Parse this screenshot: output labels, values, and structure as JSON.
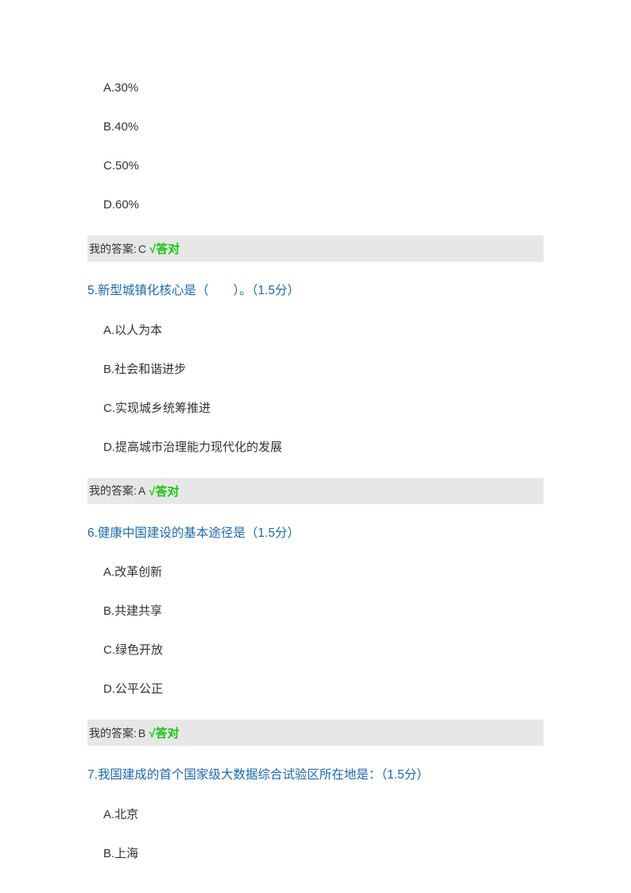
{
  "q4": {
    "options": {
      "a": "A.30%",
      "b": "B.40%",
      "c": "C.50%",
      "d": "D.60%"
    },
    "answer_label": "我的答案:",
    "answer_value": "C",
    "answer_result": "√答对"
  },
  "q5": {
    "title": "5.新型城镇化核心是（　　）。（1.5分）",
    "options": {
      "a": "A.以人为本",
      "b": "B.社会和谐进步",
      "c": "C.实现城乡统筹推进",
      "d": "D.提高城市治理能力现代化的发展"
    },
    "answer_label": "我的答案:",
    "answer_value": "A",
    "answer_result": "√答对"
  },
  "q6": {
    "title": "6.健康中国建设的基本途径是（1.5分）",
    "options": {
      "a": "A.改革创新",
      "b": "B.共建共享",
      "c": "C.绿色开放",
      "d": "D.公平公正"
    },
    "answer_label": "我的答案:",
    "answer_value": "B",
    "answer_result": "√答对"
  },
  "q7": {
    "title": "7.我国建成的首个国家级大数据综合试验区所在地是：（1.5分）",
    "options": {
      "a": "A.北京",
      "b": "B.上海"
    }
  }
}
